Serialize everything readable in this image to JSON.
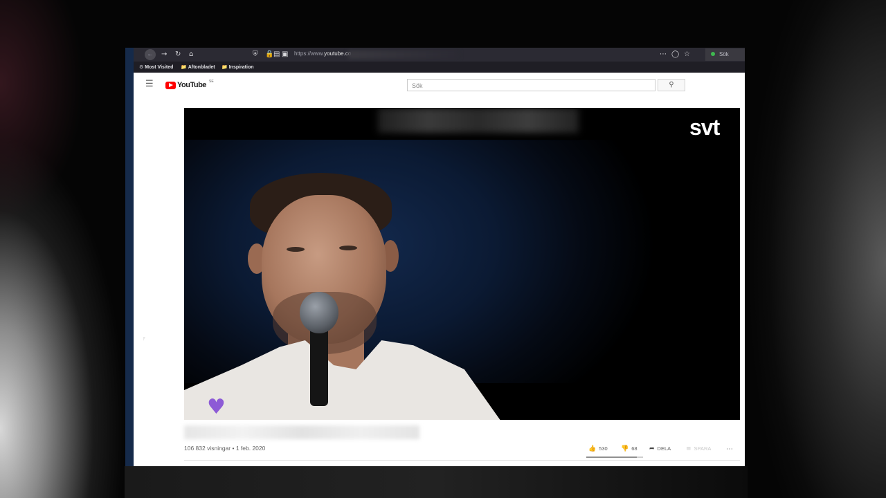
{
  "browser": {
    "url_prefix": "https://www.",
    "url_domain": "youtube.co",
    "search_placeholder": "Sök",
    "bookmarks": [
      "Most Visited",
      "Aftonbladet",
      "Inspiration"
    ],
    "icons": {
      "back": "back-arrow-icon",
      "forward": "forward-arrow-icon",
      "reload": "reload-icon",
      "home": "home-icon",
      "shield": "shield-icon",
      "lock": "lock-icon",
      "menu": "more-horizontal-icon",
      "pocket": "pocket-icon",
      "bookmark": "star-icon"
    }
  },
  "youtube": {
    "logo_text": "YouTube",
    "country_code": "SE",
    "search_placeholder": "Sök",
    "video": {
      "channel_logo": "svt",
      "views": "106 832 visningar",
      "date": "1 feb. 2020",
      "likes": "530",
      "dislikes": "68",
      "share_label": "DELA",
      "save_label": "SPARA",
      "like_ratio": 0.886
    }
  },
  "colors": {
    "youtube_red": "#ff0000",
    "browser_toolbar": "#2b2a33",
    "heart": "#8d5bd6"
  }
}
